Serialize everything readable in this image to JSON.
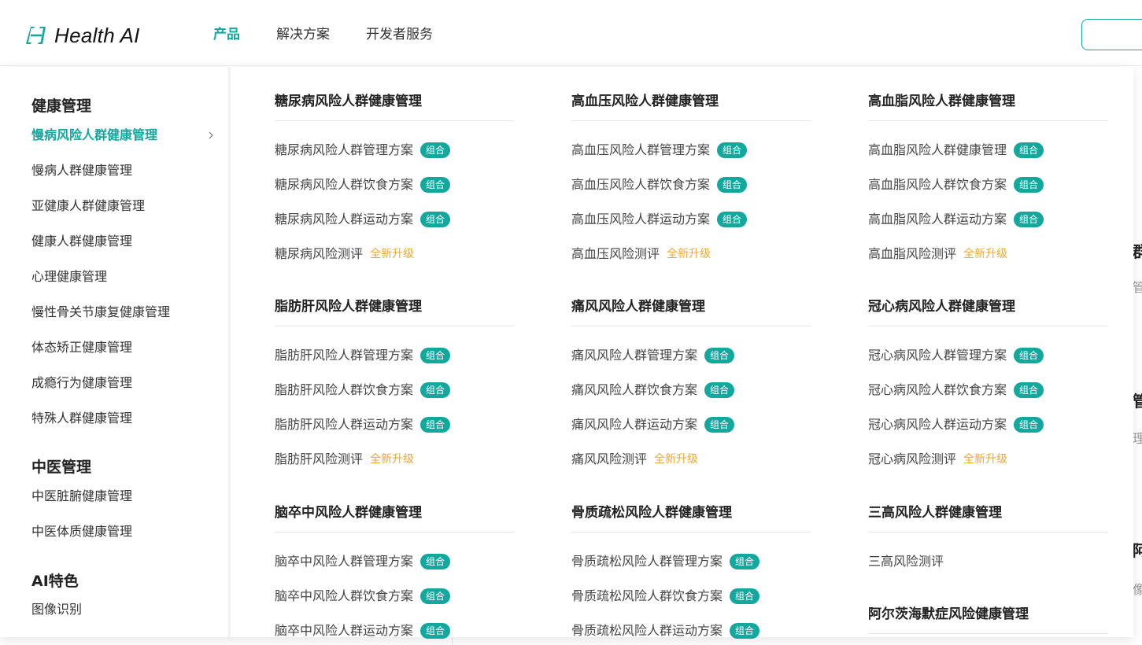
{
  "brand": {
    "name": "Health AI"
  },
  "nav": {
    "items": [
      "产品",
      "解决方案",
      "开发者服务"
    ],
    "active_index": 0
  },
  "sidebar": {
    "groups": [
      {
        "title": "健康管理",
        "items": [
          "慢病风险人群健康管理",
          "慢病人群健康管理",
          "亚健康人群健康管理",
          "健康人群健康管理",
          "心理健康管理",
          "慢性骨关节康复健康管理",
          "体态矫正健康管理",
          "成瘾行为健康管理",
          "特殊人群健康管理"
        ]
      },
      {
        "title": "中医管理",
        "items": [
          "中医脏腑健康管理",
          "中医体质健康管理"
        ]
      },
      {
        "title": "AI特色",
        "items": [
          "图像识别"
        ]
      }
    ],
    "active_item": "慢病风险人群健康管理"
  },
  "labels": {
    "combo": "组合",
    "upgrade": "全新升级"
  },
  "categories": [
    {
      "title": "糖尿病风险人群健康管理",
      "links": [
        {
          "text": "糖尿病风险人群管理方案",
          "tag": "combo"
        },
        {
          "text": "糖尿病风险人群饮食方案",
          "tag": "combo"
        },
        {
          "text": "糖尿病风险人群运动方案",
          "tag": "combo"
        },
        {
          "text": "糖尿病风险测评",
          "tag": "upgrade"
        }
      ]
    },
    {
      "title": "高血压风险人群健康管理",
      "links": [
        {
          "text": "高血压风险人群管理方案",
          "tag": "combo"
        },
        {
          "text": "高血压风险人群饮食方案",
          "tag": "combo"
        },
        {
          "text": "高血压风险人群运动方案",
          "tag": "combo"
        },
        {
          "text": "高血压风险测评",
          "tag": "upgrade"
        }
      ]
    },
    {
      "title": "高血脂风险人群健康管理",
      "links": [
        {
          "text": "高血脂风险人群健康管理",
          "tag": "combo"
        },
        {
          "text": "高血脂风险人群饮食方案",
          "tag": "combo"
        },
        {
          "text": "高血脂风险人群运动方案",
          "tag": "combo"
        },
        {
          "text": "高血脂风险测评",
          "tag": "upgrade"
        }
      ]
    },
    {
      "title": "脂肪肝风险人群健康管理",
      "links": [
        {
          "text": "脂肪肝风险人群管理方案",
          "tag": "combo"
        },
        {
          "text": "脂肪肝风险人群饮食方案",
          "tag": "combo"
        },
        {
          "text": "脂肪肝风险人群运动方案",
          "tag": "combo"
        },
        {
          "text": "脂肪肝风险测评",
          "tag": "upgrade"
        }
      ]
    },
    {
      "title": "痛风风险人群健康管理",
      "links": [
        {
          "text": "痛风风险人群管理方案",
          "tag": "combo"
        },
        {
          "text": "痛风风险人群饮食方案",
          "tag": "combo"
        },
        {
          "text": "痛风风险人群运动方案",
          "tag": "combo"
        },
        {
          "text": "痛风风险测评",
          "tag": "upgrade"
        }
      ]
    },
    {
      "title": "冠心病风险人群健康管理",
      "links": [
        {
          "text": "冠心病风险人群管理方案",
          "tag": "combo"
        },
        {
          "text": "冠心病风险人群饮食方案",
          "tag": "combo"
        },
        {
          "text": "冠心病风险人群运动方案",
          "tag": "combo"
        },
        {
          "text": "冠心病风险测评",
          "tag": "upgrade"
        }
      ]
    },
    {
      "title": "脑卒中风险人群健康管理",
      "links": [
        {
          "text": "脑卒中风险人群管理方案",
          "tag": "combo"
        },
        {
          "text": "脑卒中风险人群饮食方案",
          "tag": "combo"
        },
        {
          "text": "脑卒中风险人群运动方案",
          "tag": "combo"
        }
      ]
    },
    {
      "title": "骨质疏松风险人群健康管理",
      "links": [
        {
          "text": "骨质疏松风险人群管理方案",
          "tag": "combo"
        },
        {
          "text": "骨质疏松风险人群饮食方案",
          "tag": "combo"
        },
        {
          "text": "骨质疏松风险人群运动方案",
          "tag": "combo"
        }
      ]
    },
    {
      "title": "三高风险人群健康管理",
      "links": [
        {
          "text": "三高风险测评",
          "tag": ""
        }
      ]
    },
    {
      "title": "阿尔茨海默症风险健康管理",
      "links": []
    }
  ],
  "background_glyphs": [
    "群",
    "管",
    "管",
    "理",
    "阿",
    "像"
  ],
  "colors": {
    "accent": "#13a89e",
    "upgrade": "#f0a830"
  }
}
